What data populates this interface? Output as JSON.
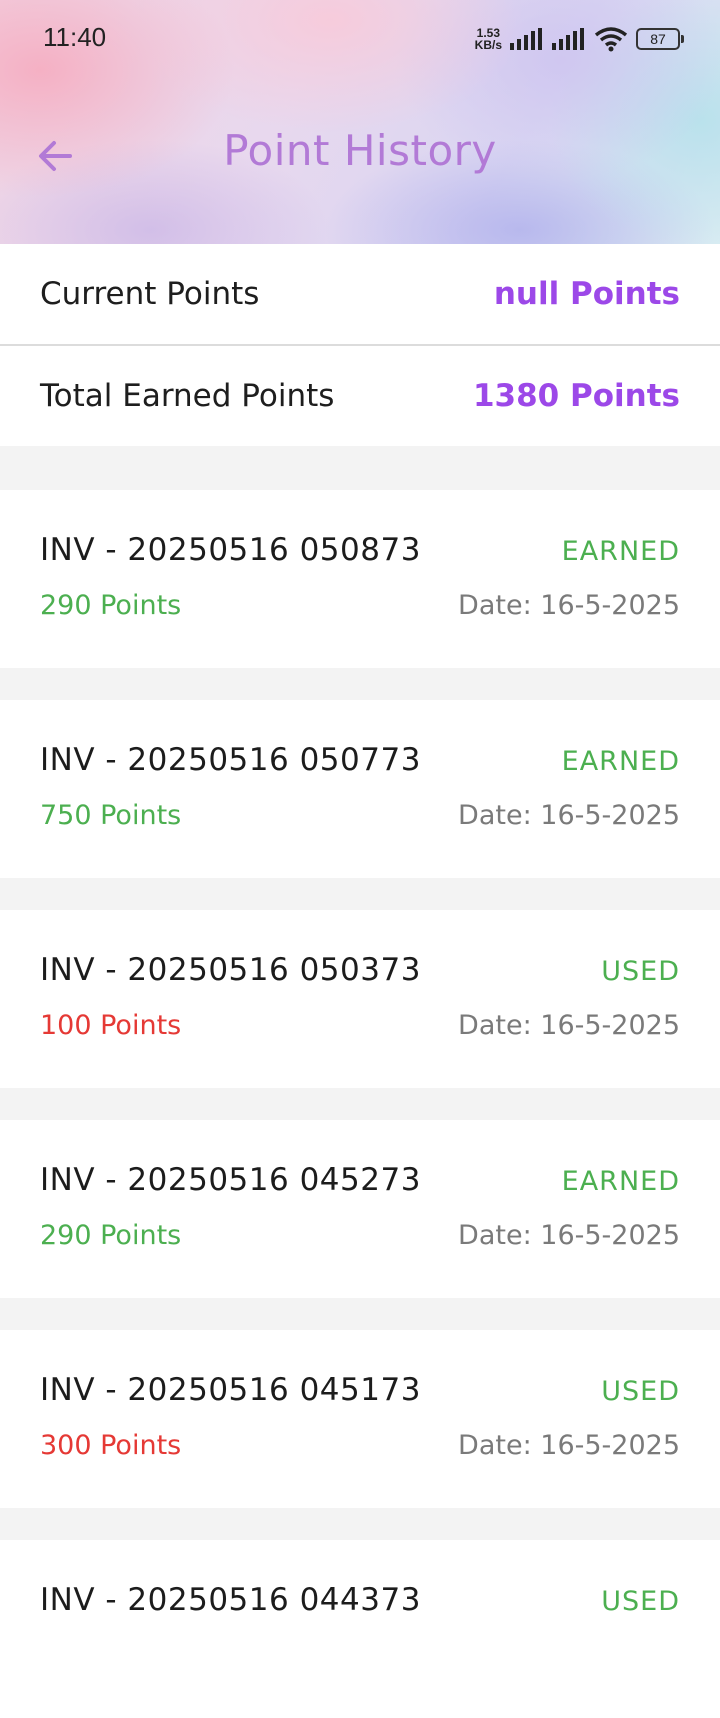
{
  "status_bar": {
    "time": "11:40",
    "net_speed_value": "1.53",
    "net_speed_unit": "KB/s",
    "battery": "87"
  },
  "header": {
    "title": "Point History",
    "back_icon": "arrow-left-icon"
  },
  "summary": {
    "current_label": "Current Points",
    "current_value": "null Points",
    "total_label": "Total Earned Points",
    "total_value": "1380 Points"
  },
  "colors": {
    "accent": "#9c48e8",
    "title": "#b27ad6",
    "earned": "#4caf50",
    "used_points": "#e53935",
    "date": "#7a7a7a"
  },
  "transactions": [
    {
      "invoice": "INV - 20250516 050873",
      "status": "EARNED",
      "points": "290 Points",
      "date": "Date: 16-5-2025",
      "type": "earned"
    },
    {
      "invoice": "INV - 20250516 050773",
      "status": "EARNED",
      "points": "750 Points",
      "date": "Date: 16-5-2025",
      "type": "earned"
    },
    {
      "invoice": "INV - 20250516 050373",
      "status": "USED",
      "points": "100 Points",
      "date": "Date: 16-5-2025",
      "type": "used"
    },
    {
      "invoice": "INV - 20250516 045273",
      "status": "EARNED",
      "points": "290 Points",
      "date": "Date: 16-5-2025",
      "type": "earned"
    },
    {
      "invoice": "INV - 20250516 045173",
      "status": "USED",
      "points": "300 Points",
      "date": "Date: 16-5-2025",
      "type": "used"
    },
    {
      "invoice": "INV - 20250516 044373",
      "status": "USED",
      "points": "",
      "date": "",
      "type": "used"
    }
  ]
}
